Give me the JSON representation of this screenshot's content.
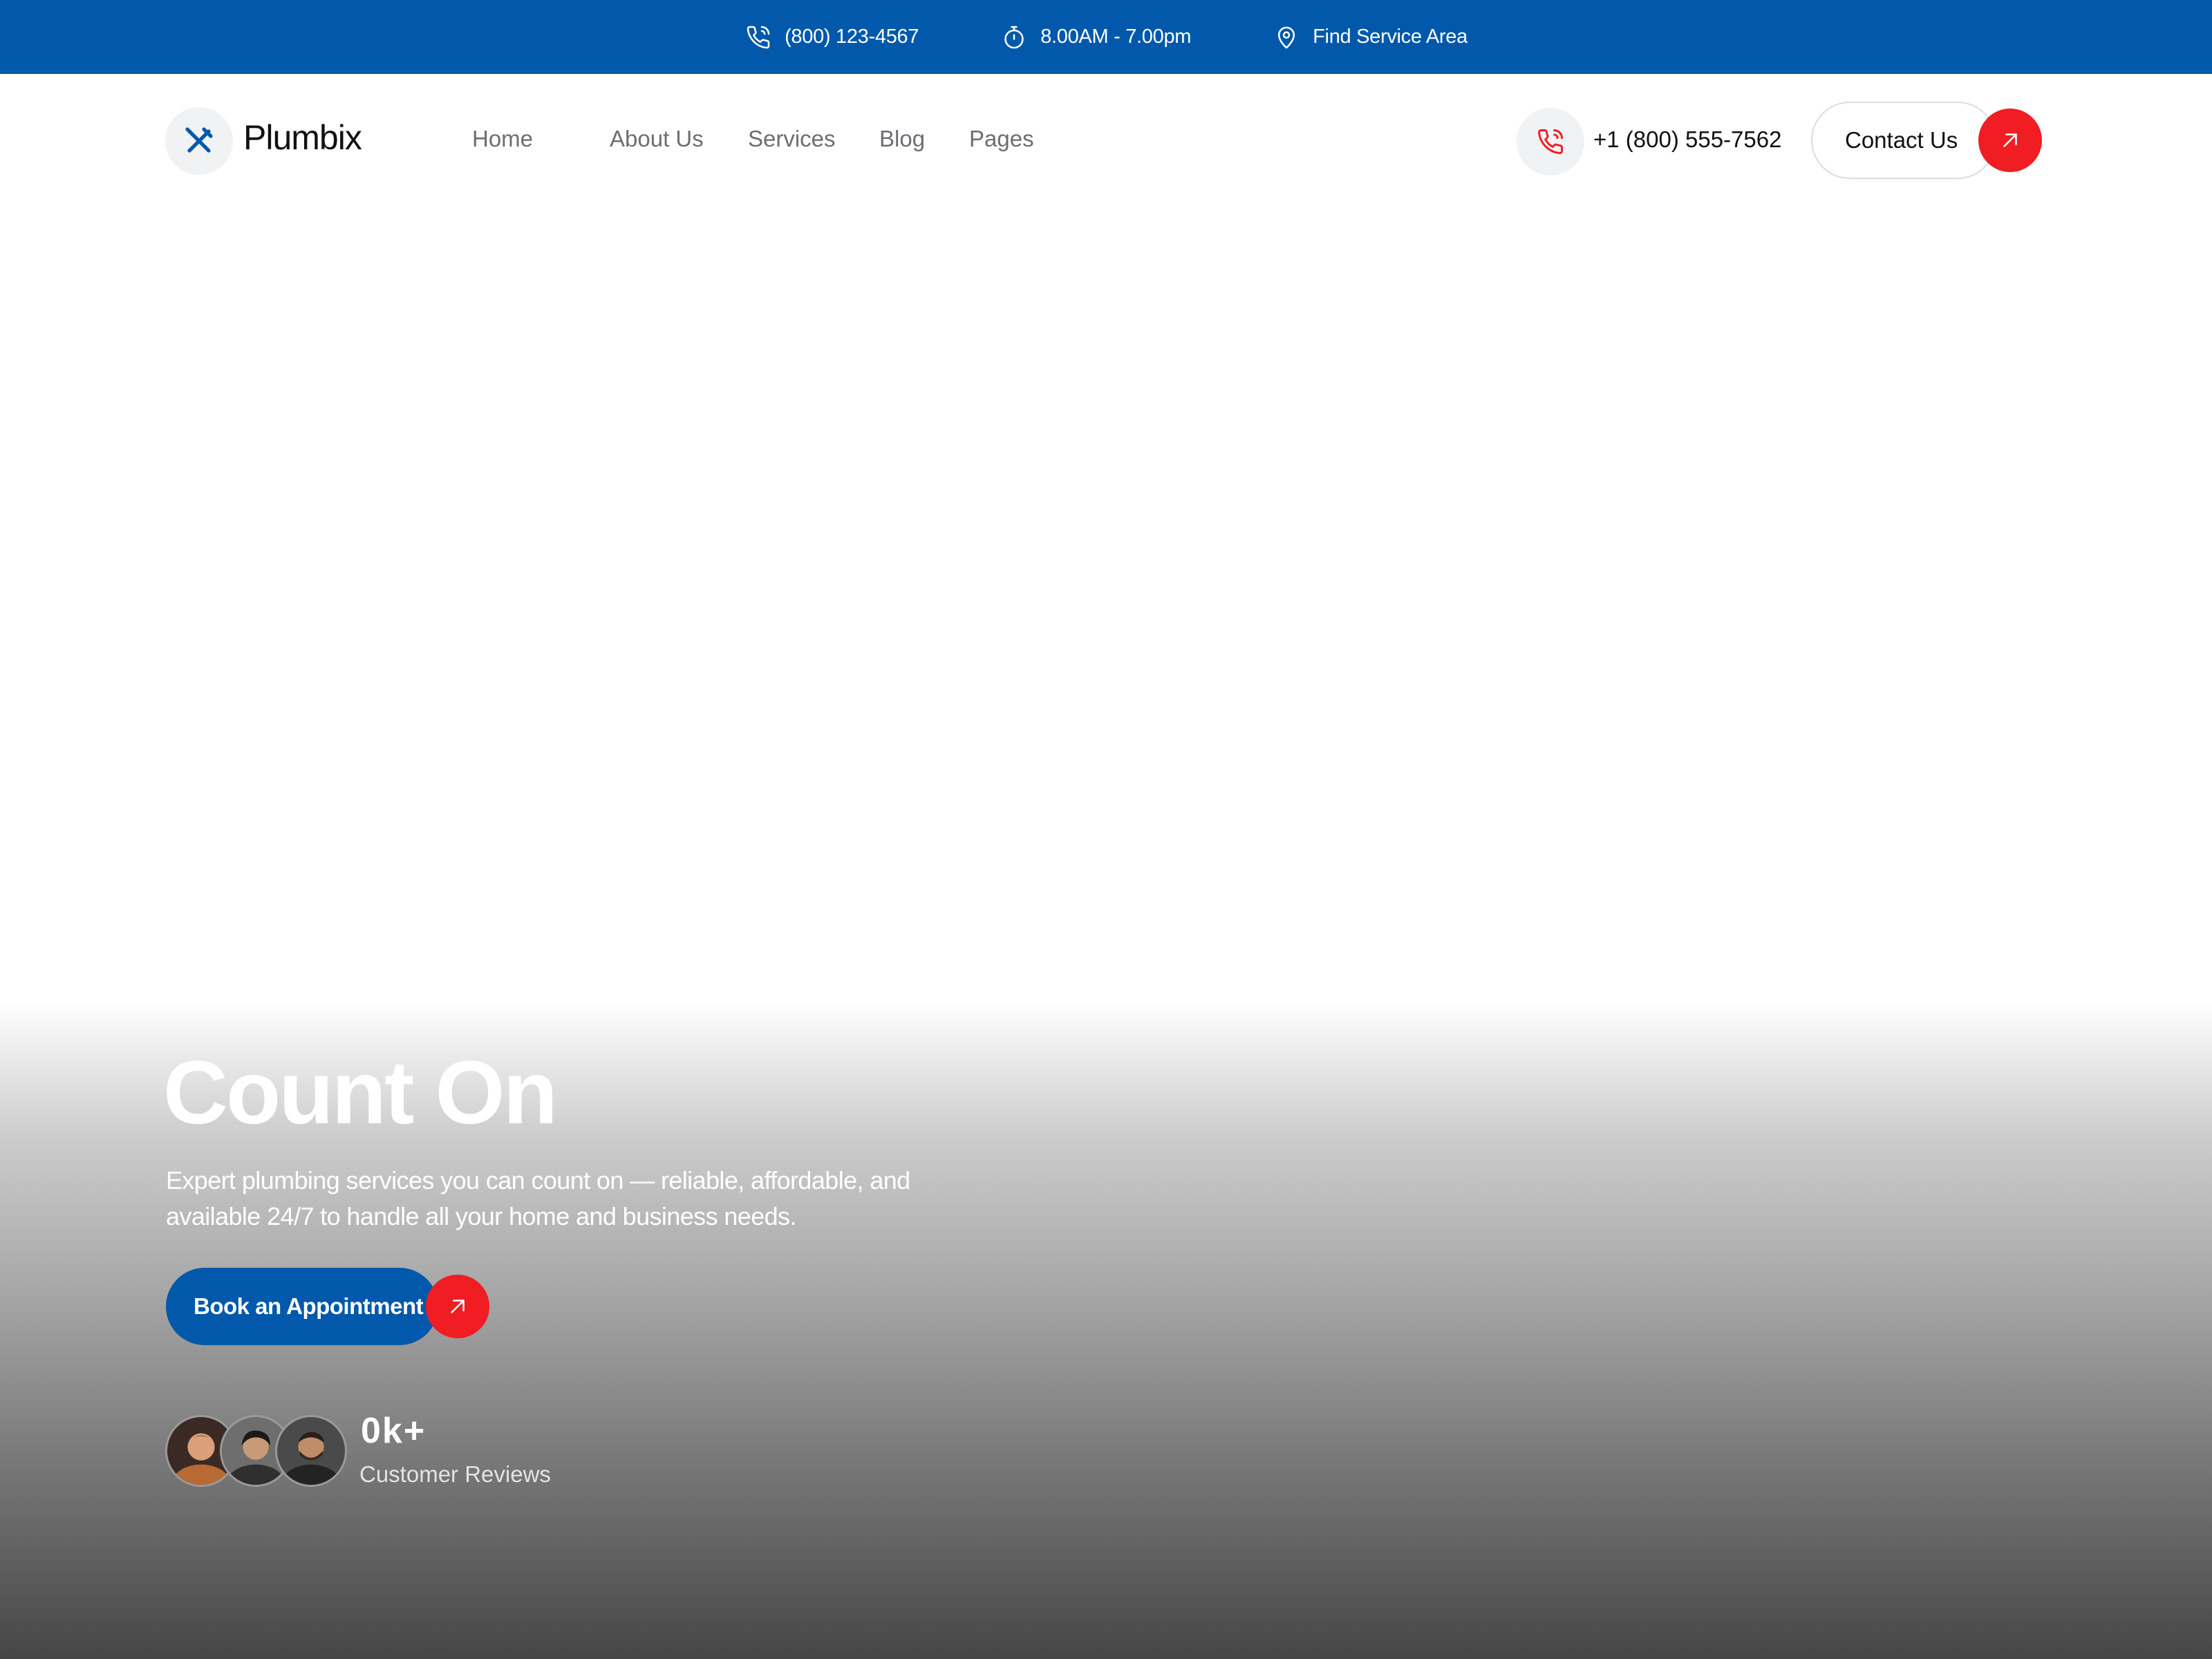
{
  "topbar": {
    "phone": "(800) 123-4567",
    "hours": "8.00AM - 7.00pm",
    "service_area": "Find Service Area"
  },
  "header": {
    "brand": "Plumbix",
    "nav": [
      "Home",
      "About Us",
      "Services",
      "Blog",
      "Pages"
    ],
    "phone": "+1 (800) 555-7562",
    "contact_label": "Contact Us"
  },
  "hero": {
    "title": "Count On",
    "subtitle_line1": "Expert plumbing services you can count on — reliable, affordable, and",
    "subtitle_line2": "available 24/7 to handle all your home and business needs.",
    "cta_label": "Book an Appointment",
    "reviews_count": "0k+",
    "reviews_label": "Customer Reviews"
  },
  "colors": {
    "brand_blue": "#0259ab",
    "accent_red": "#f01d22"
  },
  "icons": {
    "topbar": [
      "phone-icon",
      "stopwatch-icon",
      "location-pin-icon"
    ],
    "logo": "wrench-screwdriver-icon",
    "call": "phone-call-icon",
    "arrow": "arrow-up-right-icon"
  }
}
